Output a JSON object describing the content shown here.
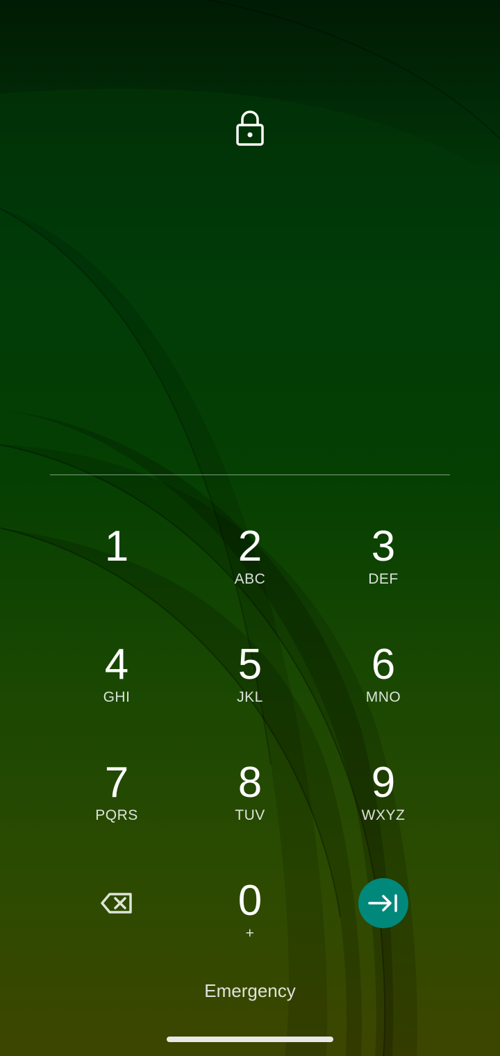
{
  "lockscreen": {
    "lock_icon": "lock-icon",
    "pin_value": "",
    "keys": [
      {
        "digit": "1",
        "letters": ""
      },
      {
        "digit": "2",
        "letters": "ABC"
      },
      {
        "digit": "3",
        "letters": "DEF"
      },
      {
        "digit": "4",
        "letters": "GHI"
      },
      {
        "digit": "5",
        "letters": "JKL"
      },
      {
        "digit": "6",
        "letters": "MNO"
      },
      {
        "digit": "7",
        "letters": "PQRS"
      },
      {
        "digit": "8",
        "letters": "TUV"
      },
      {
        "digit": "9",
        "letters": "WXYZ"
      },
      {
        "digit": "0",
        "letters": "+"
      }
    ],
    "backspace_icon": "backspace-icon",
    "enter_icon": "enter-arrow-icon",
    "enter_color": "#00897b",
    "emergency_label": "Emergency"
  },
  "navigation": {
    "gesture_handle": "gesture-handle"
  }
}
